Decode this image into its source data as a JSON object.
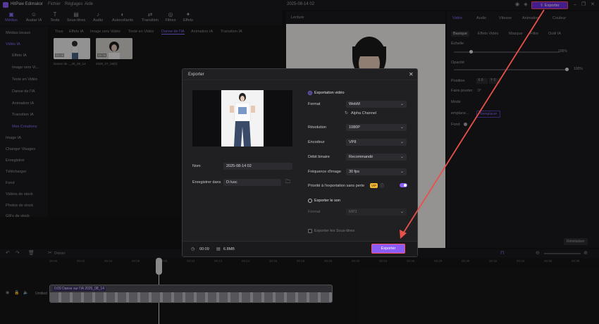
{
  "app": {
    "title": "HitPaw Edimakor",
    "menus": [
      "Fichier",
      "Réglages",
      "Aide"
    ],
    "project_date": "2025-08-14 02",
    "export_label": "Exporter"
  },
  "toolbar": {
    "items": [
      "Médias",
      "Avatar IA",
      "Texte",
      "Sous-titres",
      "Audio",
      "Autocollants",
      "Transition",
      "Filtres",
      "Effets"
    ]
  },
  "sidebar": {
    "items": [
      "Médias locaux",
      "Vidéo IA",
      "Effets IA",
      "Image vers Vi...",
      "Texte en Vidéo",
      "Danse de l'IA",
      "Animation IA",
      "Transition IA",
      "Mes Créations",
      "Image IA",
      "Changer Visages",
      "Enregistrer",
      "Télécharger",
      "Fond",
      "Vidéos de stock",
      "Photos de stock",
      "GIFs de stock"
    ]
  },
  "media": {
    "tabs": [
      "Tous",
      "Effets IA",
      "Image vers Vidéo",
      "Texte en Vidéo",
      "Danse de l'IA",
      "Animation IA",
      "Transition IA"
    ],
    "thumbs": [
      {
        "badge": "00:09",
        "label": "Danse de..._25_08_14"
      },
      {
        "badge": "00:05",
        "label": "2025_07_28(0)"
      }
    ]
  },
  "player": {
    "title": "Lecture"
  },
  "props": {
    "tabs": [
      "Vidéo",
      "Audio",
      "Vitesse",
      "Animation",
      "Couleur"
    ],
    "subtabs": [
      "Basique",
      "Effets Vidéo",
      "Masque",
      "Filtre",
      "Outil IA"
    ],
    "scale_label": "Échelle",
    "scale_value": "100%",
    "opacity_label": "Opacité",
    "opacity_value": "100%",
    "position_label": "Position",
    "pos_x": "X 0",
    "pos_y": "Y 0",
    "rotate_label": "Faire pivoter",
    "rotate_value": "0°",
    "blend_label": "Mode",
    "replace_label": "emplace...",
    "replace_value": "Remplacer",
    "fond_label": "Fond",
    "reset_label": "Réinitialiser"
  },
  "timeline": {
    "track_label": "Untitled",
    "clip_label": "0:09 Danse sur l'IA 2025_08_14",
    "ticks": [
      "00:00",
      "00:02",
      "00:04",
      "00:06",
      "00:08",
      "00:10",
      "00:12",
      "00:14",
      "00:16",
      "00:18",
      "00:20",
      "00:22",
      "00:24",
      "00:26",
      "00:28",
      "00:30",
      "00:32",
      "00:34",
      "00:36",
      "00:38"
    ],
    "split_label": "Diviser"
  },
  "dialog": {
    "title": "Exporter",
    "name_label": "Nom",
    "name_value": "2025-08-14 02",
    "save_label": "Enregistrer dans",
    "save_value": "D:/usc",
    "export_video_label": "Exportation vidéo",
    "format_label": "Format",
    "format_value": "WebM",
    "alpha_label": "Alpha Channel",
    "resolution_label": "Résolution",
    "resolution_value": "1080P",
    "encoder_label": "Encodeur",
    "encoder_value": "VP8",
    "bitrate_label": "Débit binaire",
    "bitrate_value": "Recommandé",
    "fps_label": "Fréquence d'image",
    "fps_value": "30 fps",
    "priority_label": "Priorité à l'exportation sans perte",
    "vip": "VIP",
    "export_sound_label": "Exporter le son",
    "sound_format_label": "Format",
    "sound_format_value": "MP3",
    "subtitles_label": "Exporter les Sous-titres",
    "duration": "00:09",
    "size": "6.8MB",
    "export_button": "Exporter"
  },
  "colors": {
    "accent": "#8b5cf6",
    "highlight": "#ff4f6a",
    "arrow": "#e8504a"
  }
}
